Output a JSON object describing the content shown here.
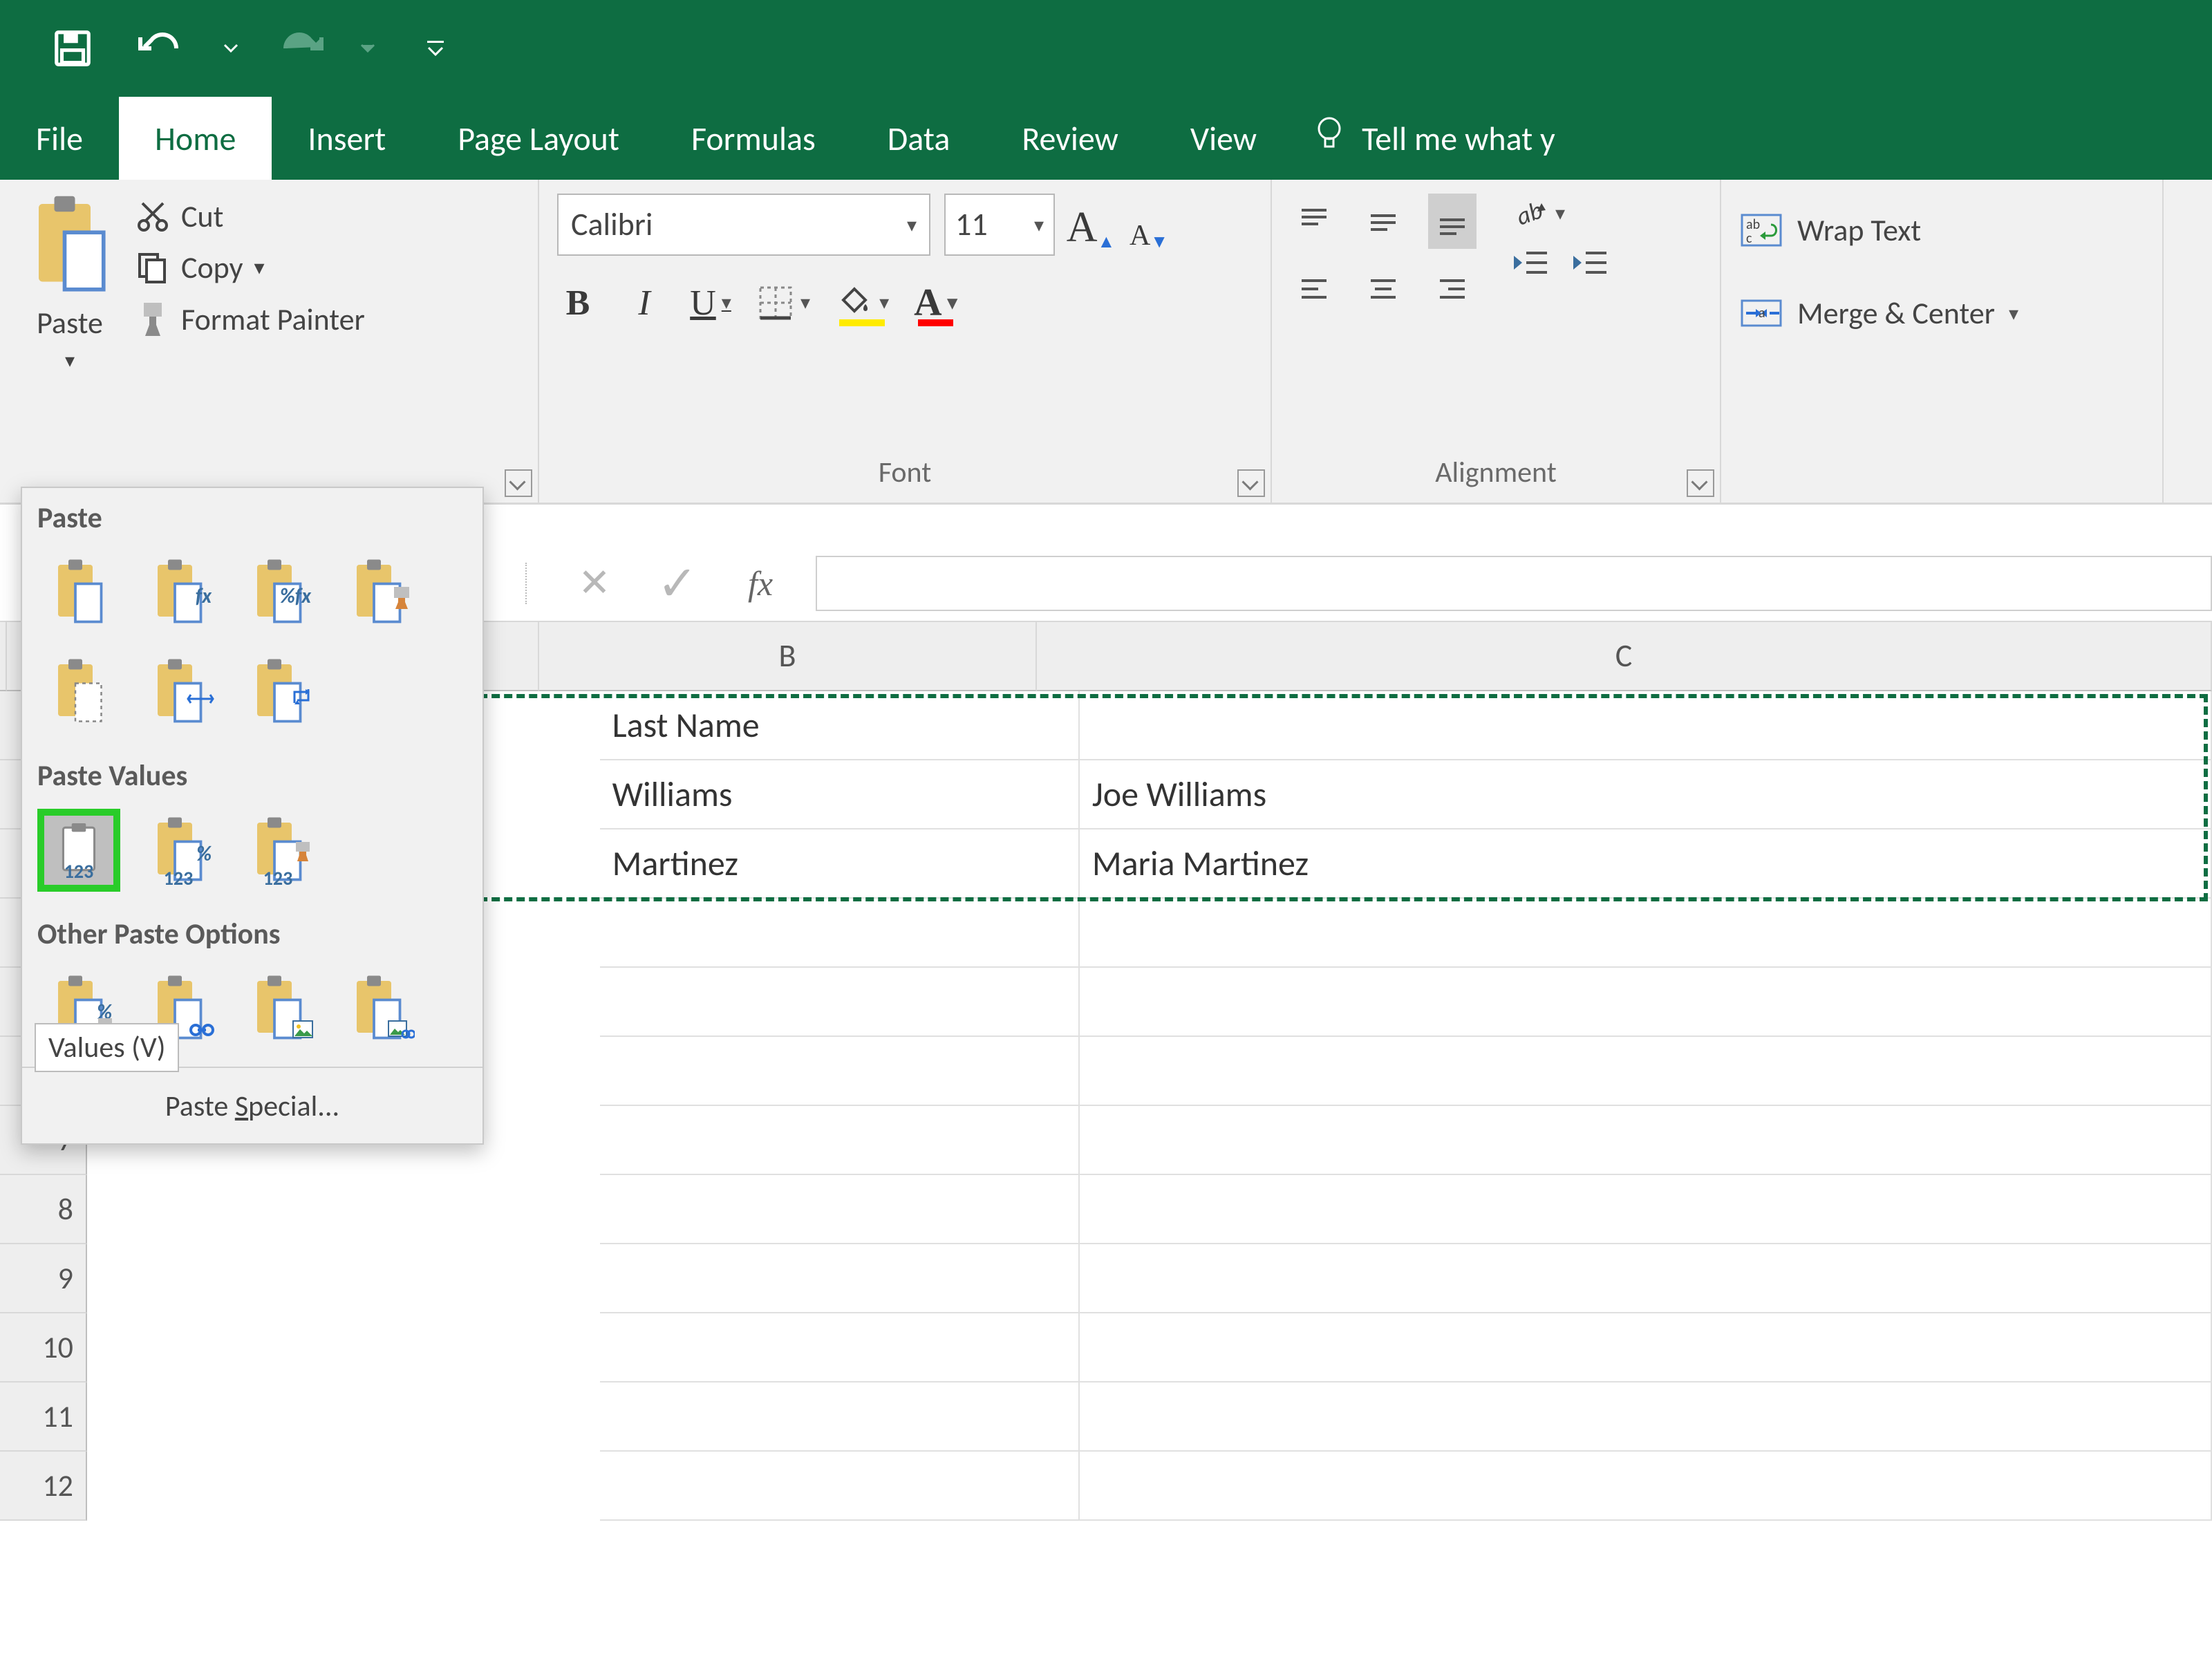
{
  "qat": {
    "save": "save",
    "undo": "undo",
    "redo": "redo"
  },
  "tabs": {
    "file": "File",
    "home": "Home",
    "insert": "Insert",
    "page_layout": "Page Layout",
    "formulas": "Formulas",
    "data": "Data",
    "review": "Review",
    "view": "View",
    "tell_me": "Tell me what y"
  },
  "clipboard": {
    "paste": "Paste",
    "cut": "Cut",
    "copy": "Copy",
    "format_painter": "Format Painter"
  },
  "font": {
    "name": "Calibri",
    "size": "11",
    "group_label": "Font",
    "bold": "B",
    "italic": "I",
    "underline": "U",
    "fill_color": "#ffeb00",
    "font_color": "#ff0000",
    "grow": "A",
    "shrink": "A"
  },
  "alignment": {
    "group_label": "Alignment",
    "wrap": "Wrap Text",
    "merge": "Merge & Center"
  },
  "paste_menu": {
    "paste_header": "Paste",
    "paste_values_header": "Paste Values",
    "other_header": "Other Paste Options",
    "tooltip": "Values (V)",
    "special_pre": "Paste ",
    "special_u": "S",
    "special_post": "pecial...",
    "fx": "fx",
    "pct_fx": "%fx",
    "pct": "%",
    "num": "123"
  },
  "formula_bar": {
    "fx": "fx"
  },
  "columns": {
    "B": "B",
    "C": "C"
  },
  "rows": {
    "r7": "7",
    "r8": "8",
    "r9": "9",
    "r10": "10",
    "r11": "11",
    "r12": "12"
  },
  "data": {
    "b1": "Last Name",
    "c1": "",
    "b2": "Williams",
    "c2": "Joe Williams",
    "b3": "Martinez",
    "c3": "Maria Martinez"
  }
}
